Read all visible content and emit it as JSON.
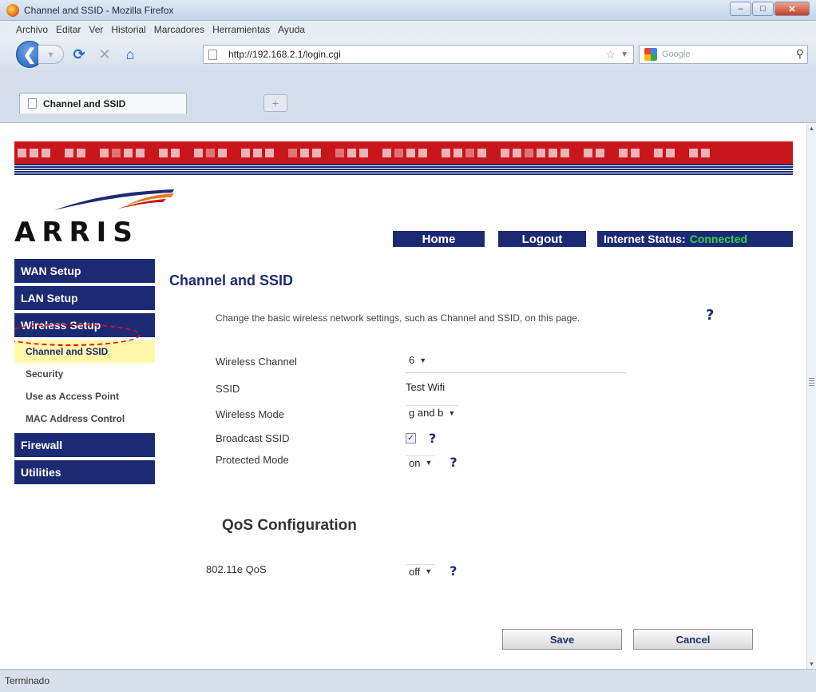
{
  "window": {
    "title": "Channel and SSID - Mozilla Firefox"
  },
  "menu": [
    "Archivo",
    "Editar",
    "Ver",
    "Historial",
    "Marcadores",
    "Herramientas",
    "Ayuda"
  ],
  "navbar": {
    "url": "http://192.168.2.1/login.cgi",
    "search_placeholder": "Google"
  },
  "tabs": [
    {
      "label": "Channel and SSID"
    }
  ],
  "header": {
    "brand": "ARRIS",
    "home": "Home",
    "logout": "Logout",
    "status_label": "Internet Status:",
    "status_value": "Connected",
    "status_color": "#2fd34a"
  },
  "sidebar": {
    "sections": [
      "WAN Setup",
      "LAN Setup",
      "Wireless Setup",
      "Firewall",
      "Utilities"
    ],
    "subitems": [
      "Channel and SSID",
      "Security",
      "Use as Access Point",
      "MAC Address Control"
    ],
    "active_subitem": "Channel and SSID"
  },
  "main": {
    "title": "Channel and SSID",
    "intro": "Change the basic wireless network settings, such as Channel and SSID, on this page.",
    "help": "?",
    "fields": {
      "channel": {
        "label": "Wireless Channel",
        "value": "6"
      },
      "ssid": {
        "label": "SSID",
        "value": "Test Wifi"
      },
      "mode": {
        "label": "Wireless Mode",
        "value": "g and b"
      },
      "broadcast": {
        "label": "Broadcast SSID",
        "checked": true
      },
      "protected": {
        "label": "Protected Mode",
        "value": "on"
      }
    },
    "qos": {
      "title": "QoS Configuration",
      "label": "802.11e QoS",
      "value": "off"
    },
    "save": "Save",
    "cancel": "Cancel"
  },
  "statusbar": {
    "text": "Terminado"
  },
  "colors": {
    "navy": "#1c2a74",
    "banner_red": "#c8161c",
    "active_highlight": "#fff8a8"
  }
}
